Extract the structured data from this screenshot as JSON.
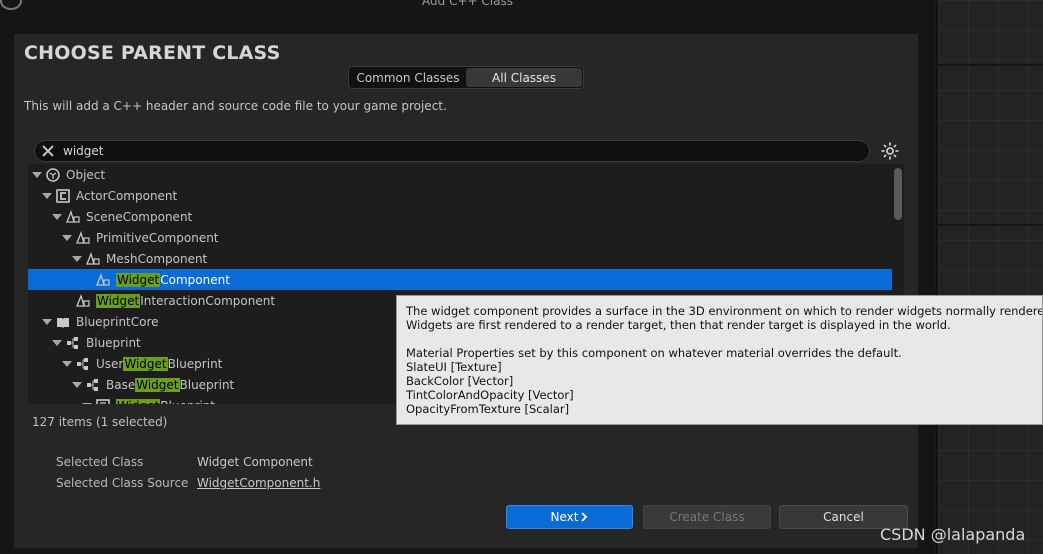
{
  "window": {
    "title": "Add C++ Class"
  },
  "dialog": {
    "title": "CHOOSE PARENT CLASS",
    "tabs": [
      {
        "label": "Common Classes",
        "active": false
      },
      {
        "label": "All Classes",
        "active": true
      }
    ],
    "description": "This will add a C++ header and source code file to your game project."
  },
  "search": {
    "value": "widget",
    "placeholder": ""
  },
  "tree": {
    "rows": [
      {
        "depth": 0,
        "pre": "Object",
        "hl": "",
        "post": "",
        "icon": "object-icon",
        "expanded": true
      },
      {
        "depth": 1,
        "pre": "ActorComponent",
        "hl": "",
        "post": "",
        "icon": "component-icon",
        "expanded": true
      },
      {
        "depth": 2,
        "pre": "SceneComponent",
        "hl": "",
        "post": "",
        "icon": "scene-component-icon",
        "expanded": true
      },
      {
        "depth": 3,
        "pre": "PrimitiveComponent",
        "hl": "",
        "post": "",
        "icon": "scene-component-icon",
        "expanded": true
      },
      {
        "depth": 4,
        "pre": "MeshComponent",
        "hl": "",
        "post": "",
        "icon": "scene-component-icon",
        "expanded": true
      },
      {
        "depth": 5,
        "pre": "",
        "hl": "Widget",
        "post": "Component",
        "icon": "scene-component-icon",
        "expanded": false,
        "selected": true
      },
      {
        "depth": 3,
        "pre": "",
        "hl": "Widget",
        "post": "InteractionComponent",
        "icon": "scene-component-icon",
        "expanded": false
      },
      {
        "depth": 1,
        "pre": "BlueprintCore",
        "hl": "",
        "post": "",
        "icon": "book-icon",
        "expanded": true
      },
      {
        "depth": 2,
        "pre": "Blueprint",
        "hl": "",
        "post": "",
        "icon": "blueprint-icon",
        "expanded": true
      },
      {
        "depth": 3,
        "pre": "User",
        "hl": "Widget",
        "post": "Blueprint",
        "icon": "blueprint-icon",
        "expanded": true
      },
      {
        "depth": 4,
        "pre": "Base",
        "hl": "Widget",
        "post": "Blueprint",
        "icon": "blueprint-icon",
        "expanded": true
      },
      {
        "depth": 5,
        "pre": "",
        "hl": "Widget",
        "post": "Blueprint",
        "icon": "widget-blueprint-icon",
        "expanded": true
      }
    ]
  },
  "status": {
    "items_count": "127 items (1 selected)"
  },
  "selection": {
    "class_label": "Selected Class",
    "class_value": "Widget Component",
    "source_label": "Selected Class Source",
    "source_value": "WidgetComponent.h"
  },
  "buttons": {
    "next": "Next",
    "create": "Create Class",
    "cancel": "Cancel"
  },
  "tooltip": {
    "lines": [
      "The widget component provides a surface in the 3D environment on which to render widgets normally rendered to the s",
      "Widgets are first rendered to a render target, then that render target is displayed in the world.",
      "",
      "Material Properties set by this component on whatever material overrides the default.",
      "SlateUI [Texture]",
      "BackColor [Vector]",
      "TintColorAndOpacity [Vector]",
      "OpacityFromTexture [Scalar]"
    ]
  },
  "watermark": "CSDN @lalapanda",
  "colors": {
    "accent": "#0a6bd6",
    "highlight": "#6b9e1f"
  }
}
